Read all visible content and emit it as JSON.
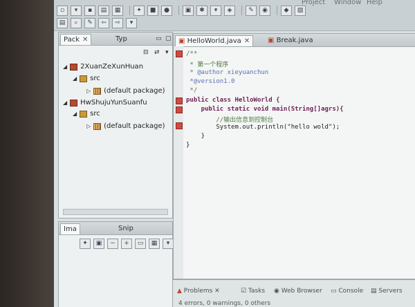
{
  "menu": {
    "project": "Project",
    "window": "Window",
    "help": "Help"
  },
  "package_explorer": {
    "tabs": [
      {
        "label": "Pack",
        "close": "✕"
      },
      {
        "label": "Typ"
      }
    ],
    "tree": [
      {
        "label": "2XuanZeXunHuan",
        "level": 0
      },
      {
        "label": "src",
        "level": 1
      },
      {
        "label": "(default package)",
        "level": 2
      },
      {
        "label": "HwShujuYunSuanfu",
        "level": 0
      },
      {
        "label": "src",
        "level": 1
      },
      {
        "label": "(default package)",
        "level": 2
      }
    ]
  },
  "lower_left": {
    "tabs": [
      {
        "label": "Ima"
      },
      {
        "label": "Snip"
      }
    ]
  },
  "editor": {
    "tabs": [
      {
        "label": "HelloWorld.java",
        "close": "✕"
      },
      {
        "label": "Break.java"
      }
    ],
    "lines": [
      {
        "text": "/**",
        "cls": "c-comment",
        "indent": 0
      },
      {
        "text": " * 第一个程序",
        "cls": "c-comment",
        "indent": 0
      },
      {
        "text": " * @author xieyuanchun",
        "cls": "c-tag",
        "indent": 0
      },
      {
        "text": " *@version1.0",
        "cls": "c-tag",
        "indent": 0
      },
      {
        "text": " */",
        "cls": "c-comment",
        "indent": 0
      },
      {
        "text": "public class HelloWorld {",
        "cls": "c-kw",
        "indent": 0
      },
      {
        "text": "    public static void main(String[]agrs){",
        "cls": "c-kw",
        "indent": 0
      },
      {
        "text": "        //输出信息到控制台",
        "cls": "c-comment",
        "indent": 0
      },
      {
        "text": "        System.out.println(\"hello wold\");",
        "cls": "c-text",
        "indent": 0
      },
      {
        "text": "    }",
        "cls": "c-text",
        "indent": 0
      },
      {
        "text": "}",
        "cls": "c-text",
        "indent": 0
      }
    ]
  },
  "bottom_panel": {
    "tabs": [
      {
        "label": "Problems ✕"
      },
      {
        "label": "Tasks"
      },
      {
        "label": "Web Browser"
      },
      {
        "label": "Console"
      },
      {
        "label": "Servers"
      }
    ],
    "status": "4 errors, 0 warnings, 0 others"
  },
  "colors": {
    "error_marker": "#d04a40",
    "keyword": "#6e1f55",
    "comment": "#4f7a45"
  }
}
